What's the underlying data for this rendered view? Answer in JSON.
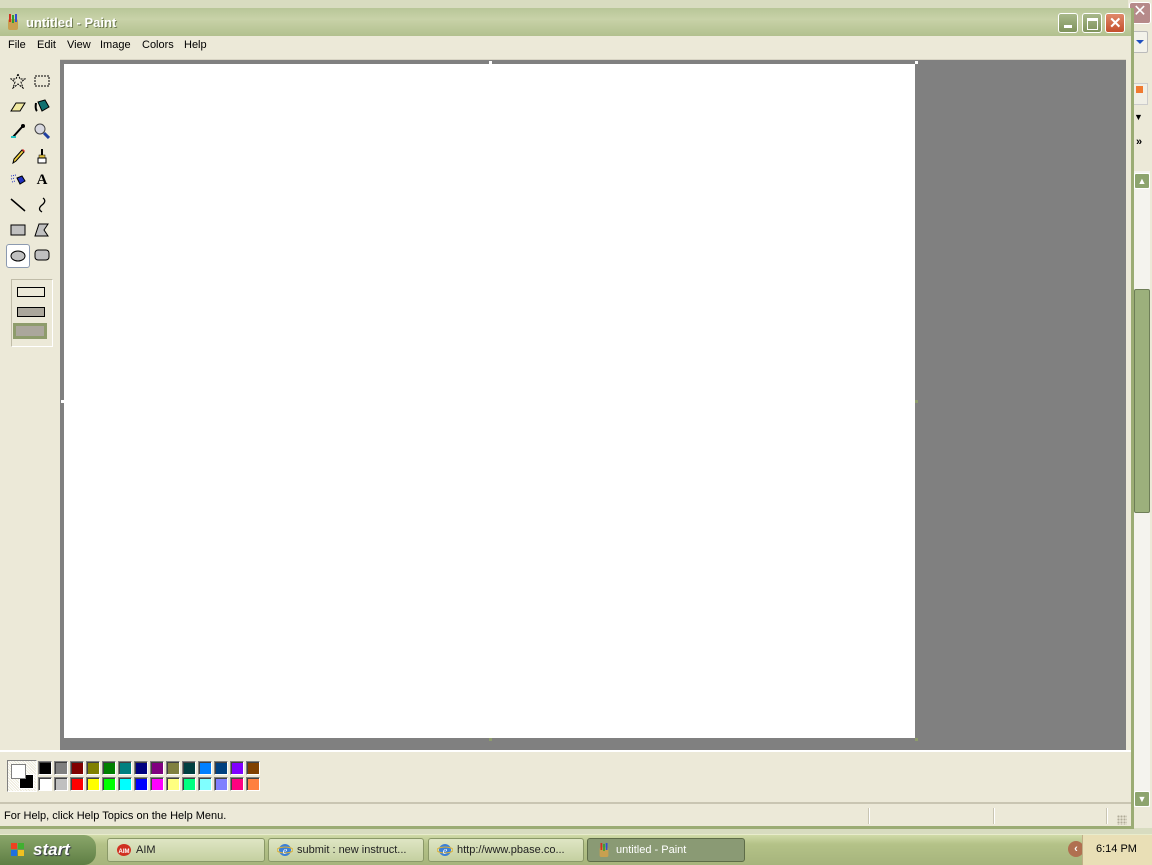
{
  "window": {
    "title": "untitled - Paint",
    "buttons": {
      "minimize": "_",
      "maximize": "□",
      "close": "✕"
    }
  },
  "menubar": [
    "File",
    "Edit",
    "View",
    "Image",
    "Colors",
    "Help"
  ],
  "tools": [
    {
      "name": "free-form-select",
      "glyph": "☆"
    },
    {
      "name": "rect-select",
      "glyph": "⬚"
    },
    {
      "name": "eraser",
      "glyph": "▱"
    },
    {
      "name": "fill",
      "glyph": "◢"
    },
    {
      "name": "pick-color",
      "glyph": "✎"
    },
    {
      "name": "magnifier",
      "glyph": "🔍"
    },
    {
      "name": "pencil",
      "glyph": "✏"
    },
    {
      "name": "brush",
      "glyph": "♜"
    },
    {
      "name": "airbrush",
      "glyph": "⚗"
    },
    {
      "name": "text",
      "glyph": "A"
    },
    {
      "name": "line",
      "glyph": "╲"
    },
    {
      "name": "curve",
      "glyph": "≀"
    },
    {
      "name": "rectangle",
      "glyph": "▭"
    },
    {
      "name": "polygon",
      "glyph": "▰"
    },
    {
      "name": "ellipse",
      "glyph": "⬭",
      "selected": true
    },
    {
      "name": "rounded-rectangle",
      "glyph": "▢"
    }
  ],
  "colors": {
    "foreground": "#ffffff",
    "background": "#000000",
    "palette_top": [
      "#000000",
      "#808080",
      "#800000",
      "#808000",
      "#008000",
      "#008080",
      "#000080",
      "#800080",
      "#808040",
      "#004040",
      "#0080ff",
      "#004080",
      "#8000ff",
      "#804000"
    ],
    "palette_bottom": [
      "#ffffff",
      "#c0c0c0",
      "#ff0000",
      "#ffff00",
      "#00ff00",
      "#00ffff",
      "#0000ff",
      "#ff00ff",
      "#ffff80",
      "#00ff80",
      "#80ffff",
      "#8080ff",
      "#ff0080",
      "#ff8040"
    ]
  },
  "status": {
    "help_text": "For Help, click Help Topics on the Help Menu."
  },
  "taskbar": {
    "start_label": "start",
    "tasks": [
      {
        "label": "AIM",
        "icon": "aim-icon"
      },
      {
        "label": "submit : new instruct...",
        "icon": "ie-icon"
      },
      {
        "label": "http://www.pbase.co...",
        "icon": "ie-icon"
      },
      {
        "label": "untitled - Paint",
        "icon": "paint-icon",
        "active": true
      }
    ],
    "clock": "6:14 PM"
  }
}
